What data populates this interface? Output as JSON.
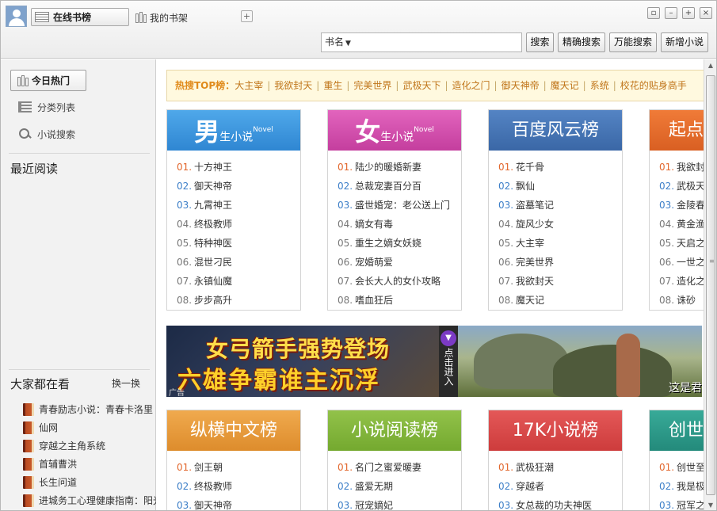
{
  "header": {
    "tab_online": "在线书榜",
    "tab_shelf": "我的书架",
    "add_tab": "+",
    "search_field": "书名",
    "btn_search": "搜索",
    "btn_exact": "精确搜索",
    "btn_universal": "万能搜索",
    "btn_add_novel": "新增小说",
    "win_restore": "▫",
    "win_min": "–",
    "win_max": "+",
    "win_close": "×"
  },
  "sidebar": {
    "today_hot": "今日热门",
    "category_list": "分类列表",
    "novel_search": "小说搜索",
    "recent_reading": "最近阅读",
    "everyone_reading": "大家都在看",
    "refresh": "换一换",
    "books": [
      "青春励志小说：青春卡洛里",
      "仙网",
      "穿越之主角系统",
      "首辅曹洪",
      "长生问道",
      "进城务工心理健康指南：阳光"
    ]
  },
  "hot_search": {
    "label": "热搜TOP榜：",
    "keywords": [
      "大主宰",
      "我欲封天",
      "重生",
      "完美世界",
      "武极天下",
      "造化之门",
      "御天神帝",
      "魔天记",
      "系统",
      "校花的贴身高手"
    ]
  },
  "boards": [
    {
      "title_big": "男",
      "title_small": "生",
      "title_mini": "小说",
      "title_sup": "Novel",
      "color": "#3a97de",
      "items": [
        "十方神王",
        "御天神帝",
        "九霄神王",
        "终极教师",
        "特种神医",
        "混世刁民",
        "永镇仙魔",
        "步步高升"
      ]
    },
    {
      "title_big": "女",
      "title_small": "生",
      "title_mini": "小说",
      "title_sup": "Novel",
      "color": "#d64bab",
      "items": [
        "陆少的暖婚新妻",
        "总裁宠妻百分百",
        "盛世婚宠：老公送上门",
        "嫡女有毒",
        "重生之嫡女妖娆",
        "宠婚萌爱",
        "会长大人的女仆攻略",
        "嗜血狂后"
      ]
    },
    {
      "title": "百度风云榜",
      "color": "#3f6fae",
      "items": [
        "花千骨",
        "飘仙",
        "盗墓笔记",
        "旋风少女",
        "大主宰",
        "完美世界",
        "我欲封天",
        "魔天记"
      ]
    },
    {
      "title": "起点",
      "color": "#e36a2a",
      "items": [
        "我欲封",
        "武极天",
        "金陵春",
        "黄金渔",
        "天启之",
        "一世之",
        "造化之",
        "诛砂"
      ]
    }
  ],
  "ad": {
    "line1": "女弓箭手强势登场",
    "line2": "六雄争霸谁主沉浮",
    "tag": "广告",
    "click": "点击进入",
    "right_text": "这是君"
  },
  "boards2": [
    {
      "title": "纵横中文榜",
      "color": "#e59a3a",
      "items": [
        "剑王朝",
        "终极教师",
        "御天神帝"
      ]
    },
    {
      "title": "小说阅读榜",
      "color": "#7fb43a",
      "items": [
        "名门之蜜爱暖妻",
        "盛爱无期",
        "冠宠嫡妃"
      ]
    },
    {
      "title": "17K小说榜",
      "color": "#d94646",
      "items": [
        "武极狂潮",
        "穿越者",
        "女总裁的功夫神医"
      ]
    },
    {
      "title": "创世",
      "color": "#2d9a8a",
      "items": [
        "创世至",
        "我是极",
        "冠军之"
      ]
    }
  ],
  "rank_numbers": [
    "01.",
    "02.",
    "03.",
    "04.",
    "05.",
    "06.",
    "07.",
    "08."
  ]
}
